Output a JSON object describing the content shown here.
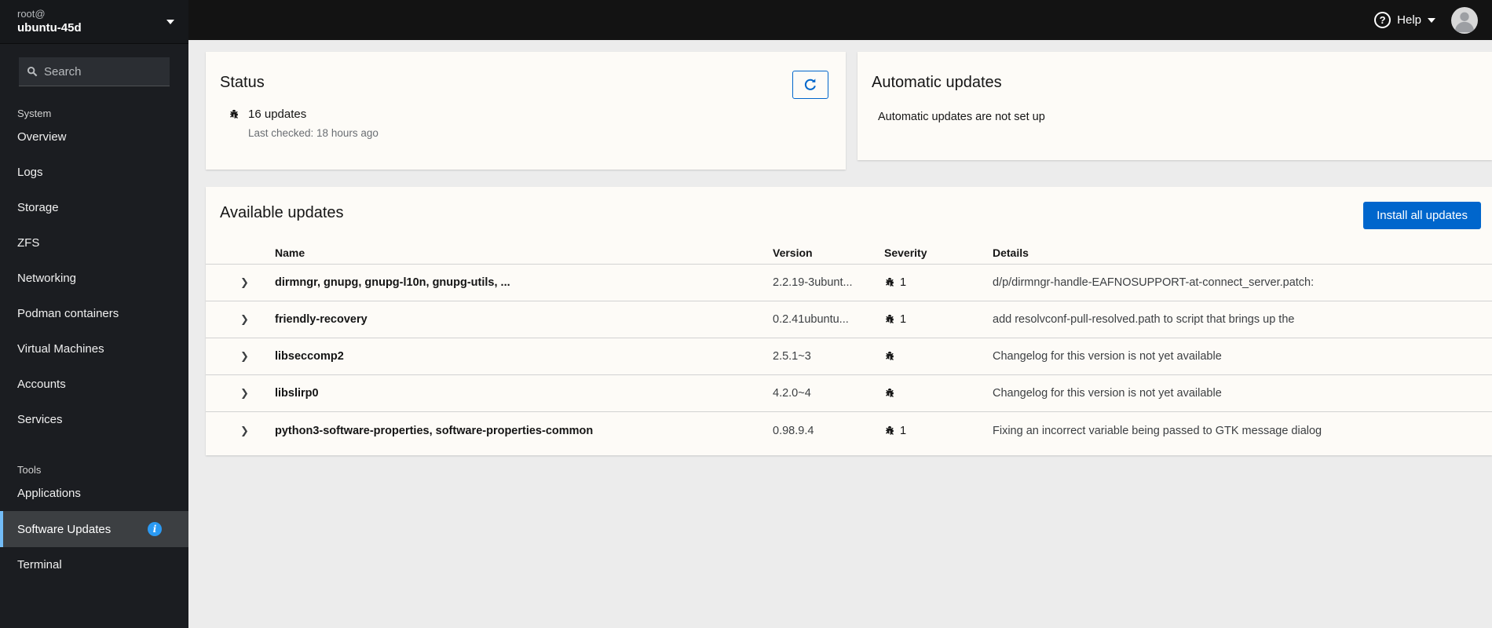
{
  "colors": {
    "accent_blue": "#0066cc",
    "selected_item_border": "#73bcf7",
    "info_badge": "#2b9af3",
    "sidebar_bg": "#1b1d21",
    "card_bg": "#fdfbf7"
  },
  "host_switcher": {
    "user": "root@",
    "host": "ubuntu-45d"
  },
  "search": {
    "placeholder": "Search"
  },
  "sidebar": {
    "sections": [
      {
        "label": "System",
        "items": [
          {
            "label": "Overview"
          },
          {
            "label": "Logs"
          },
          {
            "label": "Storage"
          },
          {
            "label": "ZFS"
          },
          {
            "label": "Networking"
          },
          {
            "label": "Podman containers"
          },
          {
            "label": "Virtual Machines"
          },
          {
            "label": "Accounts"
          },
          {
            "label": "Services"
          }
        ]
      },
      {
        "label": "Tools",
        "items": [
          {
            "label": "Applications"
          },
          {
            "label": "Software Updates",
            "selected": true,
            "info_badge": "i"
          },
          {
            "label": "Terminal"
          }
        ]
      }
    ]
  },
  "topbar": {
    "help_label": "Help"
  },
  "status_card": {
    "title": "Status",
    "updates_summary": "16 updates",
    "last_checked": "Last checked: 18 hours ago"
  },
  "auto_updates_card": {
    "title": "Automatic updates",
    "message": "Automatic updates are not set up"
  },
  "updates_card": {
    "title": "Available updates",
    "install_button_label": "Install all updates",
    "columns": {
      "name": "Name",
      "version": "Version",
      "severity": "Severity",
      "details": "Details"
    },
    "rows": [
      {
        "name": "dirmngr, gnupg, gnupg-l10n, gnupg-utils, ...",
        "version": "2.2.19-3ubunt...",
        "severity_count": "1",
        "details": "d/p/dirmngr-handle-EAFNOSUPPORT-at-connect_server.patch:"
      },
      {
        "name": "friendly-recovery",
        "version": "0.2.41ubuntu...",
        "severity_count": "1",
        "details": "add resolvconf-pull-resolved.path to script that brings up the"
      },
      {
        "name": "libseccomp2",
        "version": "2.5.1~3",
        "severity_count": "",
        "details": "Changelog for this version is not yet available"
      },
      {
        "name": "libslirp0",
        "version": "4.2.0~4",
        "severity_count": "",
        "details": "Changelog for this version is not yet available"
      },
      {
        "name": "python3-software-properties, software-properties-common",
        "version": "0.98.9.4",
        "severity_count": "1",
        "details": "Fixing an incorrect variable being passed to GTK message dialog"
      }
    ]
  }
}
